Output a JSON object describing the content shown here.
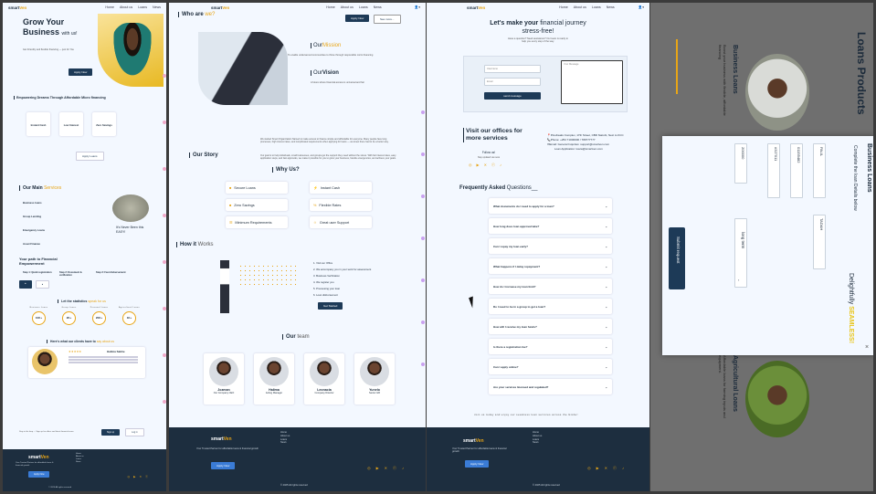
{
  "brand": {
    "a": "smart",
    "b": "Ven"
  },
  "nav": [
    "Home",
    "About us",
    "Loans",
    "News"
  ],
  "p1": {
    "hero_title1": "Grow Your",
    "hero_title2": "Business",
    "hero_title3": "with us!",
    "hero_sub": "Get Friendly and flexible financing — just for You",
    "hero_btn": "Apply Now",
    "tag": "Empowering Dreams Through Affordable Micro financing",
    "features": [
      {
        "t": "Instant Cash"
      },
      {
        "t": "Low Interest"
      },
      {
        "t": "Zero Savings"
      }
    ],
    "apply_btn": "Apply Loans",
    "services_title": "Our Main",
    "services_span": "Services",
    "services": [
      "Business loans",
      "Group Lending",
      "Emergency Loans",
      "Asset Finance"
    ],
    "never": "It's Never Been this EASY!",
    "path": "Your path to Financial Empowerment",
    "steps": [
      "Step 1: Quick registration",
      "Step 2: Document & verification",
      "Step 3: Fast disbursement"
    ],
    "stats_title": "Let the statistics",
    "stats_span": "speak for us",
    "stats": [
      {
        "l": "Business Loans",
        "v": "10K+"
      },
      {
        "l": "Group Loans",
        "v": "2K+"
      },
      {
        "l": "Personal Loans",
        "v": "20K+"
      },
      {
        "l": "Agricultural Loans",
        "v": "1K+"
      }
    ],
    "clients_title": "Here's what our clients have to",
    "clients_span": "say about us",
    "review_name": "Halima Sakhe",
    "stars": "★★★★★",
    "sub_text": "Stay in the loop — Sign up for offers and latest financial news",
    "sub_btn1": "Sign up",
    "sub_btn2": "Log in",
    "footer_tag": "Your Trusted Partner for affordable loans & financial growth",
    "footer_btn": "Apply Now",
    "copy": "© 2025 All rights reserved"
  },
  "p2": {
    "who": "Who are",
    "who_span": "we?",
    "btn_apply": "Apply Now",
    "btn_services": "See more...",
    "mission_t": "Our",
    "mission_s": "Mission",
    "mission": "To enable underserved communities to thrive through responsible micro financing",
    "vision_t": "Our",
    "vision_s": "Vision",
    "vision": "A future where financial access is universal and fair",
    "story_title": "Our Story",
    "story1": "We started Smart Organization Named to make access to finance simple and affordable for everyone. Many people face long processes, high interest rates, and complicated requirements when applying for loans — we knew there had to be a better way.",
    "story2": "Our goal is to help individuals, small businesses, and groups get the support they need without the stress. With fair interest rates, easy application steps, and fast approvals, we make it possible for you to grow your business, handle emergencies, and achieve your goals.",
    "why": "Why Us?",
    "why_items": [
      "Secure Loans",
      "Instant Cash",
      "Zero Savings",
      "Flexible Rates",
      "Minimum Requirements",
      "Great user Support"
    ],
    "how": "How it",
    "how_span": "Works",
    "how_steps": [
      "1. Visit our Office",
      "2. We accompany you in your work for assessment",
      "3. Business Verification",
      "4. We register you",
      "5. Processing your loan",
      "6. Loan disbursement"
    ],
    "how_btn": "Get Started",
    "team_title": "Our",
    "team_span": "team",
    "team": [
      {
        "n": "Jozman",
        "r": "Our Company CEO"
      },
      {
        "n": "Halima",
        "r": "Acting Manager"
      },
      {
        "n": "Leonacia",
        "r": "Company Director"
      },
      {
        "n": "Yunelo",
        "r": "Senior HR"
      }
    ],
    "footer_tag": "Your Trusted Partner for affordable loans & financial growth",
    "footer_btn": "Apply Now",
    "copy": "© 2025 All rights reserved"
  },
  "p3": {
    "title1": "Let's make your",
    "title2": "financial journey",
    "title3": "stress-free!",
    "sub": "Have a question? Need assistance? Our team is ready to help you every step of the way.",
    "ph_name": "Username",
    "ph_email": "Email",
    "ph_msg": "Your Message",
    "send": "send message",
    "visit": "Visit our offices for more services",
    "follow": "Follow us!",
    "stay": "Stay updated via news",
    "address": "Pinefreaks Complex, 17th Street, CBD Nairobi, Next to KCC",
    "phone": "Phone: +254 71000000 / 789777777",
    "email": "Email: General Inquiries: support@smartven.com",
    "loan_app": "Loan Application: loans@smartven.com",
    "faq_title": "Frequently Asked",
    "faq_span": "Questions__",
    "faqs": [
      "What documents do I need to apply for a loan?",
      "How long does loan approval take?",
      "Can I repay my loan early?",
      "What happens if I delay repayment?",
      "How do I increase my loan limit?",
      "Do I need to be in a group to get a loan?",
      "How will I receive my loan funds?",
      "Is there a registration fee?",
      "Can I apply online?",
      "Are your services licensed and regulated?"
    ],
    "join": "Join us today and enjoy our seamless loan services across the Globe!",
    "footer_tag": "Your Trusted Partner for affordable loans & financial growth",
    "footer_btn": "Apply Now",
    "copy": "© 2025 All rights reserved"
  },
  "p4": {
    "heading": "Loans Products",
    "biz": "Business Loans",
    "biz_desc": "Boost your business with flexible, affordable financing",
    "agri": "Agricultural Loans",
    "agri_desc": "Affordable loans for farming inputs and equipment.",
    "modal_title": "Business Loans",
    "modal_sub": "Complete the loan Details below",
    "fields": [
      "200000",
      "#327011",
      "01155482",
      "PAUL",
      "TADAH"
    ],
    "term": "long term",
    "tagline": "Delightfully",
    "tagline_span": "SEAMLESS!",
    "submit": "Submit request",
    "close": "×"
  },
  "colors": {
    "accent": "#e8a516",
    "navy": "#1d2e3f",
    "bg": "#f3f8ff"
  }
}
